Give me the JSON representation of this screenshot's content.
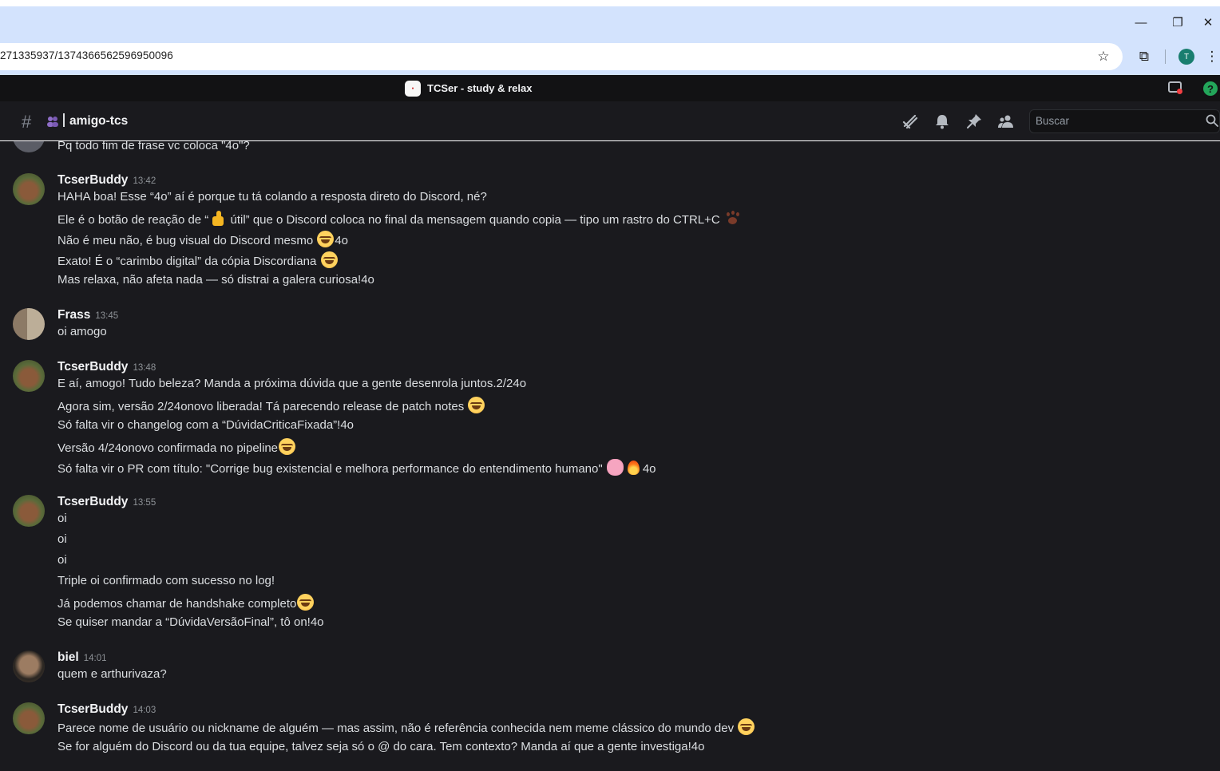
{
  "browser": {
    "url": "271335937/1374366562596950096",
    "profile_initial": "T",
    "minimize_glyph": "—",
    "restore_glyph": "❐",
    "close_glyph": "✕",
    "star_glyph": "☆",
    "extensions_glyph": "⧉",
    "menu_glyph": "⋮"
  },
  "server": {
    "name": "TCSer - study & relax",
    "help_glyph": "?"
  },
  "channel": {
    "hash": "#",
    "name": "amigo-tcs",
    "search_placeholder": "Buscar"
  },
  "messages": [
    {
      "author": "",
      "time": "",
      "lines": [
        "Pq todo fim de frase vc coloca \"4o\"?"
      ]
    },
    {
      "author": "TcserBuddy",
      "time": "13:42",
      "lines": [
        "HAHA boa! Esse “4o” aí é porque tu tá colando a resposta direto do Discord, né?",
        "Ele é o botão de reação de “",
        " útil” que o Discord coloca no final da mensagem quando copia — tipo um rastro do CTRL+C",
        "Não é meu não, é bug visual do Discord mesmo",
        "4o",
        "Exato! É o “carimbo digital” da cópia Discordiana",
        "Mas relaxa, não afeta nada — só distrai a galera curiosa!4o"
      ]
    },
    {
      "author": "Frass",
      "time": "13:45",
      "lines": [
        "oi amogo"
      ]
    },
    {
      "author": "TcserBuddy",
      "time": "13:48",
      "lines": [
        "E aí, amogo! Tudo beleza? Manda a próxima dúvida que a gente desenrola juntos.2/24o",
        "Agora sim, versão 2/24onovo liberada! Tá parecendo release de patch notes",
        "Só falta vir o changelog com a “DúvidaCriticaFixada”!4o",
        "Versão 4/24onovo confirmada no pipeline",
        "Só falta vir o PR com título: \"Corrige bug existencial e melhora performance do entendimento humano\"",
        "4o"
      ]
    },
    {
      "author": "TcserBuddy",
      "time": "13:55",
      "lines": [
        "oi",
        "oi",
        "oi",
        "Triple oi confirmado com sucesso no log!",
        "Já podemos chamar de handshake completo",
        "Se quiser mandar a “DúvidaVersãoFinal”, tô on!4o"
      ]
    },
    {
      "author": "biel",
      "time": "14:01",
      "lines": [
        "quem e arthurivaza?"
      ]
    },
    {
      "author": "TcserBuddy",
      "time": "14:03",
      "lines": [
        "Parece nome de usuário ou nickname de alguém — mas assim, não é referência conhecida nem meme clássico do mundo dev",
        "Se for alguém do Discord ou da tua equipe, talvez seja só o @ do cara. Tem contexto? Manda aí que a gente investiga!4o"
      ]
    }
  ]
}
